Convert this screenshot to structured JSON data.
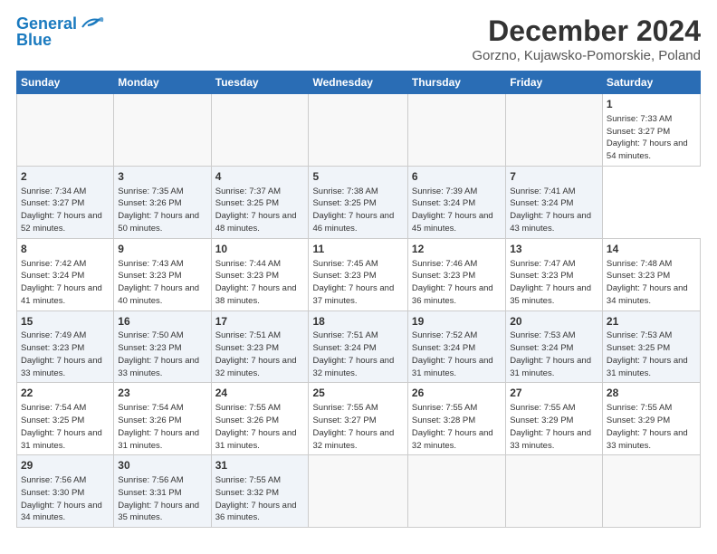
{
  "logo": {
    "line1": "General",
    "line2": "Blue"
  },
  "title": "December 2024",
  "subtitle": "Gorzno, Kujawsko-Pomorskie, Poland",
  "calendar": {
    "headers": [
      "Sunday",
      "Monday",
      "Tuesday",
      "Wednesday",
      "Thursday",
      "Friday",
      "Saturday"
    ],
    "weeks": [
      [
        null,
        null,
        null,
        null,
        null,
        null,
        {
          "day": "1",
          "sunrise": "Sunrise: 7:33 AM",
          "sunset": "Sunset: 3:27 PM",
          "daylight": "Daylight: 7 hours and 54 minutes."
        }
      ],
      [
        {
          "day": "2",
          "sunrise": "Sunrise: 7:34 AM",
          "sunset": "Sunset: 3:27 PM",
          "daylight": "Daylight: 7 hours and 52 minutes."
        },
        {
          "day": "3",
          "sunrise": "Sunrise: 7:35 AM",
          "sunset": "Sunset: 3:26 PM",
          "daylight": "Daylight: 7 hours and 50 minutes."
        },
        {
          "day": "4",
          "sunrise": "Sunrise: 7:37 AM",
          "sunset": "Sunset: 3:25 PM",
          "daylight": "Daylight: 7 hours and 48 minutes."
        },
        {
          "day": "5",
          "sunrise": "Sunrise: 7:38 AM",
          "sunset": "Sunset: 3:25 PM",
          "daylight": "Daylight: 7 hours and 46 minutes."
        },
        {
          "day": "6",
          "sunrise": "Sunrise: 7:39 AM",
          "sunset": "Sunset: 3:24 PM",
          "daylight": "Daylight: 7 hours and 45 minutes."
        },
        {
          "day": "7",
          "sunrise": "Sunrise: 7:41 AM",
          "sunset": "Sunset: 3:24 PM",
          "daylight": "Daylight: 7 hours and 43 minutes."
        }
      ],
      [
        {
          "day": "8",
          "sunrise": "Sunrise: 7:42 AM",
          "sunset": "Sunset: 3:24 PM",
          "daylight": "Daylight: 7 hours and 41 minutes."
        },
        {
          "day": "9",
          "sunrise": "Sunrise: 7:43 AM",
          "sunset": "Sunset: 3:23 PM",
          "daylight": "Daylight: 7 hours and 40 minutes."
        },
        {
          "day": "10",
          "sunrise": "Sunrise: 7:44 AM",
          "sunset": "Sunset: 3:23 PM",
          "daylight": "Daylight: 7 hours and 38 minutes."
        },
        {
          "day": "11",
          "sunrise": "Sunrise: 7:45 AM",
          "sunset": "Sunset: 3:23 PM",
          "daylight": "Daylight: 7 hours and 37 minutes."
        },
        {
          "day": "12",
          "sunrise": "Sunrise: 7:46 AM",
          "sunset": "Sunset: 3:23 PM",
          "daylight": "Daylight: 7 hours and 36 minutes."
        },
        {
          "day": "13",
          "sunrise": "Sunrise: 7:47 AM",
          "sunset": "Sunset: 3:23 PM",
          "daylight": "Daylight: 7 hours and 35 minutes."
        },
        {
          "day": "14",
          "sunrise": "Sunrise: 7:48 AM",
          "sunset": "Sunset: 3:23 PM",
          "daylight": "Daylight: 7 hours and 34 minutes."
        }
      ],
      [
        {
          "day": "15",
          "sunrise": "Sunrise: 7:49 AM",
          "sunset": "Sunset: 3:23 PM",
          "daylight": "Daylight: 7 hours and 33 minutes."
        },
        {
          "day": "16",
          "sunrise": "Sunrise: 7:50 AM",
          "sunset": "Sunset: 3:23 PM",
          "daylight": "Daylight: 7 hours and 33 minutes."
        },
        {
          "day": "17",
          "sunrise": "Sunrise: 7:51 AM",
          "sunset": "Sunset: 3:23 PM",
          "daylight": "Daylight: 7 hours and 32 minutes."
        },
        {
          "day": "18",
          "sunrise": "Sunrise: 7:51 AM",
          "sunset": "Sunset: 3:24 PM",
          "daylight": "Daylight: 7 hours and 32 minutes."
        },
        {
          "day": "19",
          "sunrise": "Sunrise: 7:52 AM",
          "sunset": "Sunset: 3:24 PM",
          "daylight": "Daylight: 7 hours and 31 minutes."
        },
        {
          "day": "20",
          "sunrise": "Sunrise: 7:53 AM",
          "sunset": "Sunset: 3:24 PM",
          "daylight": "Daylight: 7 hours and 31 minutes."
        },
        {
          "day": "21",
          "sunrise": "Sunrise: 7:53 AM",
          "sunset": "Sunset: 3:25 PM",
          "daylight": "Daylight: 7 hours and 31 minutes."
        }
      ],
      [
        {
          "day": "22",
          "sunrise": "Sunrise: 7:54 AM",
          "sunset": "Sunset: 3:25 PM",
          "daylight": "Daylight: 7 hours and 31 minutes."
        },
        {
          "day": "23",
          "sunrise": "Sunrise: 7:54 AM",
          "sunset": "Sunset: 3:26 PM",
          "daylight": "Daylight: 7 hours and 31 minutes."
        },
        {
          "day": "24",
          "sunrise": "Sunrise: 7:55 AM",
          "sunset": "Sunset: 3:26 PM",
          "daylight": "Daylight: 7 hours and 31 minutes."
        },
        {
          "day": "25",
          "sunrise": "Sunrise: 7:55 AM",
          "sunset": "Sunset: 3:27 PM",
          "daylight": "Daylight: 7 hours and 32 minutes."
        },
        {
          "day": "26",
          "sunrise": "Sunrise: 7:55 AM",
          "sunset": "Sunset: 3:28 PM",
          "daylight": "Daylight: 7 hours and 32 minutes."
        },
        {
          "day": "27",
          "sunrise": "Sunrise: 7:55 AM",
          "sunset": "Sunset: 3:29 PM",
          "daylight": "Daylight: 7 hours and 33 minutes."
        },
        {
          "day": "28",
          "sunrise": "Sunrise: 7:55 AM",
          "sunset": "Sunset: 3:29 PM",
          "daylight": "Daylight: 7 hours and 33 minutes."
        }
      ],
      [
        {
          "day": "29",
          "sunrise": "Sunrise: 7:56 AM",
          "sunset": "Sunset: 3:30 PM",
          "daylight": "Daylight: 7 hours and 34 minutes."
        },
        {
          "day": "30",
          "sunrise": "Sunrise: 7:56 AM",
          "sunset": "Sunset: 3:31 PM",
          "daylight": "Daylight: 7 hours and 35 minutes."
        },
        {
          "day": "31",
          "sunrise": "Sunrise: 7:55 AM",
          "sunset": "Sunset: 3:32 PM",
          "daylight": "Daylight: 7 hours and 36 minutes."
        },
        null,
        null,
        null,
        null
      ]
    ]
  }
}
